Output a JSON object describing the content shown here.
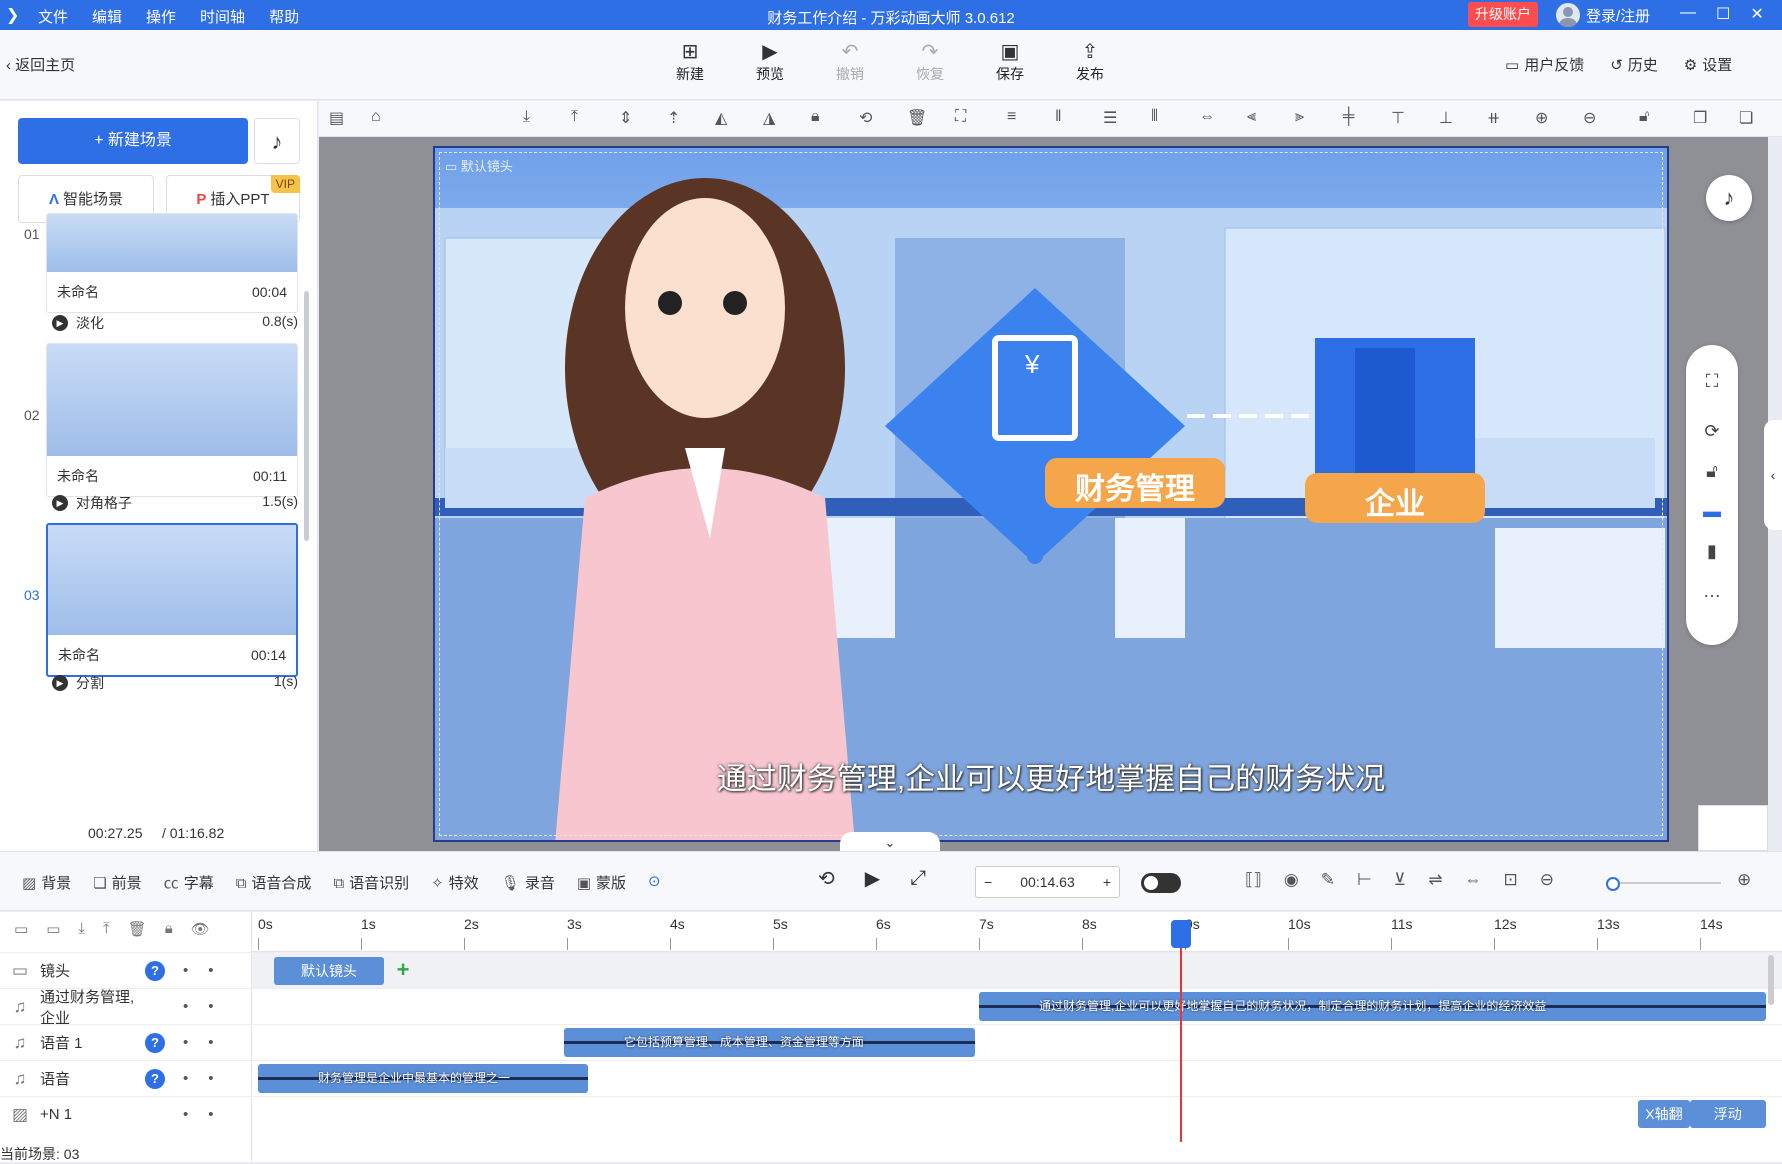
{
  "window": {
    "title": "财务工作介绍 - 万彩动画大师 3.0.612",
    "menu": [
      "文件",
      "编辑",
      "操作",
      "时间轴",
      "帮助"
    ],
    "upgrade_label": "升级账户",
    "login_label": "登录/注册"
  },
  "toolbar": {
    "back_label": "返回主页",
    "buttons": [
      {
        "label": "新建",
        "icon": "plus-square-icon",
        "enabled": true
      },
      {
        "label": "预览",
        "icon": "play-icon",
        "enabled": true
      },
      {
        "label": "撤销",
        "icon": "undo-icon",
        "enabled": false
      },
      {
        "label": "恢复",
        "icon": "redo-icon",
        "enabled": false
      },
      {
        "label": "保存",
        "icon": "save-icon",
        "enabled": true
      },
      {
        "label": "发布",
        "icon": "publish-icon",
        "enabled": true
      }
    ],
    "right": [
      {
        "label": "用户反馈",
        "icon": "feedback-icon"
      },
      {
        "label": "历史",
        "icon": "history-icon"
      },
      {
        "label": "设置",
        "icon": "gear-icon"
      }
    ]
  },
  "left_panel": {
    "new_scene_label": "+ 新建场景",
    "smart_scene_label": "智能场景",
    "insert_ppt_label": "插入PPT",
    "vip_badge": "VIP",
    "scenes": [
      {
        "num": "01",
        "name": "未命名",
        "duration": "00:04",
        "transition": "淡化",
        "transition_time": "0.8(s)",
        "selected": false
      },
      {
        "num": "02",
        "name": "未命名",
        "duration": "00:11",
        "transition": "对角格子",
        "transition_time": "1.5(s)",
        "selected": false
      },
      {
        "num": "03",
        "name": "未命名",
        "duration": "00:14",
        "transition": "分割",
        "transition_time": "1(s)",
        "selected": true
      }
    ],
    "current_time": "00:27.25",
    "total_time": "/ 01:16.82"
  },
  "canvas": {
    "camera_label": "默认镜头",
    "subtitle": "通过财务管理,企业可以更好地掌握自己的财务状况",
    "badge_left": "财务管理",
    "badge_right": "企业"
  },
  "timeline_toolbar": {
    "tools": [
      {
        "label": "背景",
        "icon": "background-icon"
      },
      {
        "label": "前景",
        "icon": "foreground-icon"
      },
      {
        "label": "字幕",
        "icon": "caption-icon"
      },
      {
        "label": "语音合成",
        "icon": "tts-icon"
      },
      {
        "label": "语音识别",
        "icon": "speech-recognition-icon"
      },
      {
        "label": "特效",
        "icon": "effects-icon"
      },
      {
        "label": "录音",
        "icon": "microphone-icon"
      },
      {
        "label": "蒙版",
        "icon": "mask-icon"
      }
    ],
    "current_time": "00:14.63"
  },
  "timeline": {
    "ticks": [
      "0s",
      "1s",
      "2s",
      "3s",
      "4s",
      "5s",
      "6s",
      "7s",
      "8s",
      "9s",
      "10s",
      "11s",
      "12s",
      "13s",
      "14s"
    ],
    "tracks": [
      {
        "name": "镜头",
        "icon": "camera-icon",
        "help": true
      },
      {
        "name": "通过财务管理,企业",
        "icon": "music-note-icon",
        "help": false
      },
      {
        "name": "语音 1",
        "icon": "music-note-icon",
        "help": true
      },
      {
        "name": "语音",
        "icon": "music-note-icon",
        "help": true
      },
      {
        "name": "+N 1",
        "icon": "image-icon",
        "help": false
      }
    ],
    "camera_clip": "默认镜头",
    "audio_clips": [
      {
        "track": 1,
        "text": "通过财务管理,企业可以更好地掌握自己的财务状况，制定合理的财务计划，提高企业的经济效益",
        "start_s": 7.0,
        "end_s": 14.64
      },
      {
        "track": 2,
        "text": "它包括预算管理、成本管理、资金管理等方面",
        "start_s": 2.97,
        "end_s": 6.96
      },
      {
        "track": 3,
        "text": "财务管理是企业中最基本的管理之一",
        "start_s": 0.0,
        "end_s": 3.2
      }
    ],
    "effect_clips": [
      {
        "label": "X轴翻",
        "start_s": 13.4,
        "end_s": 13.9
      },
      {
        "label": "浮动",
        "start_s": 13.9,
        "end_s": 14.64
      }
    ],
    "playhead_s": 8.95,
    "current_scene_label": "当前场景: 03"
  },
  "colors": {
    "accent": "#2f6fe6",
    "clip": "#5b8fd8",
    "upgrade": "#ff4d4f",
    "playhead": "#e33333",
    "badge": "#f5a54a"
  }
}
